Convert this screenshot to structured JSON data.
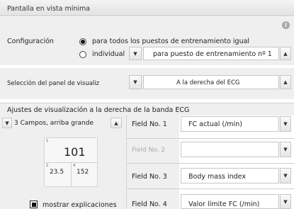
{
  "window": {
    "title": "Pantalla en vista mínima"
  },
  "configuracion": {
    "label": "Configuración",
    "option_all": "para todos los puestos de entrenamiento igual",
    "option_individual": "individual",
    "individual_selected": false,
    "puesto_value": "para puesto de entrenamiento nº 1"
  },
  "panel_selection": {
    "label": "Selección del panel de visualiz",
    "value": "A la derecha del ECG"
  },
  "ajustes": {
    "header": "Ajustes de visualización a la derecha de la banda ECG",
    "layout_value": "3 Campos, arriba grande"
  },
  "preview": {
    "big_value": "101",
    "small_left": "23.5",
    "small_right": "152",
    "corner_1": "1",
    "corner_2": "2",
    "corner_3": "4"
  },
  "fields": [
    {
      "label": "Field No. 1",
      "value": "FC actual (/min)",
      "enabled": true
    },
    {
      "label": "Field No. 2",
      "value": "",
      "enabled": false
    },
    {
      "label": "Field No. 3",
      "value": "Body mass index",
      "enabled": true
    },
    {
      "label": "Field No. 4",
      "value": "Valor límite FC (/min)",
      "enabled": true
    }
  ],
  "mostrar": {
    "label": "mostrar explicaciones",
    "checked": true
  }
}
